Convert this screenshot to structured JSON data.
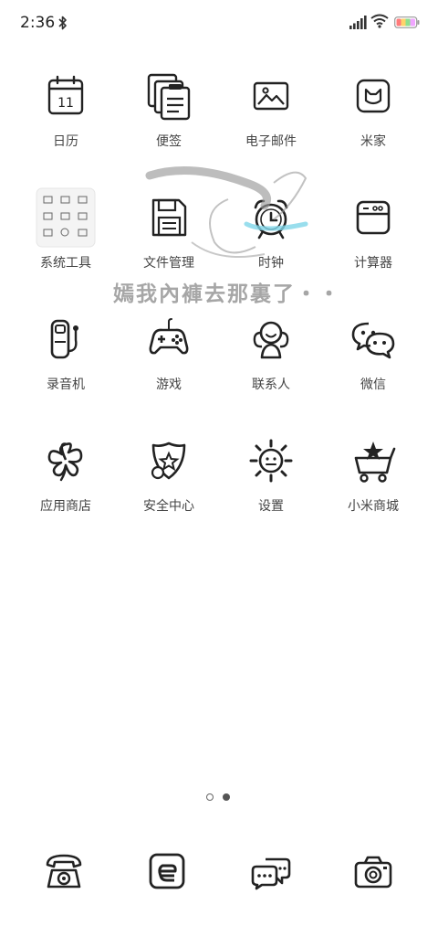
{
  "status_bar": {
    "time": "2:36",
    "icons": [
      "bluetooth-icon",
      "signal-icon",
      "wifi-icon",
      "battery-icon"
    ],
    "battery_colors": [
      "#ff6b6b",
      "#ffd93d",
      "#6bcB77",
      "#4d96ff"
    ]
  },
  "apps": [
    {
      "label": "日历",
      "icon": "calendar-icon",
      "day": "11"
    },
    {
      "label": "便签",
      "icon": "notes-icon"
    },
    {
      "label": "电子邮件",
      "icon": "email-icon"
    },
    {
      "label": "米家",
      "icon": "mijia-icon"
    },
    {
      "label": "系统工具",
      "icon": "system-tools-folder-icon"
    },
    {
      "label": "文件管理",
      "icon": "file-manager-icon"
    },
    {
      "label": "时钟",
      "icon": "clock-icon"
    },
    {
      "label": "计算器",
      "icon": "calculator-icon"
    },
    {
      "label": "录音机",
      "icon": "recorder-icon"
    },
    {
      "label": "游戏",
      "icon": "gamepad-icon"
    },
    {
      "label": "联系人",
      "icon": "contacts-icon"
    },
    {
      "label": "微信",
      "icon": "wechat-icon"
    },
    {
      "label": "应用商店",
      "icon": "app-store-icon"
    },
    {
      "label": "安全中心",
      "icon": "security-center-icon"
    },
    {
      "label": "设置",
      "icon": "settings-icon"
    },
    {
      "label": "小米商城",
      "icon": "mi-store-icon"
    }
  ],
  "watermark": {
    "text": "嫣我內褲去那裏了・・"
  },
  "page_indicator": {
    "pages": 2,
    "current": 2
  },
  "dock": [
    {
      "icon": "phone-icon"
    },
    {
      "icon": "browser-icon"
    },
    {
      "icon": "messages-icon"
    },
    {
      "icon": "camera-icon"
    }
  ]
}
